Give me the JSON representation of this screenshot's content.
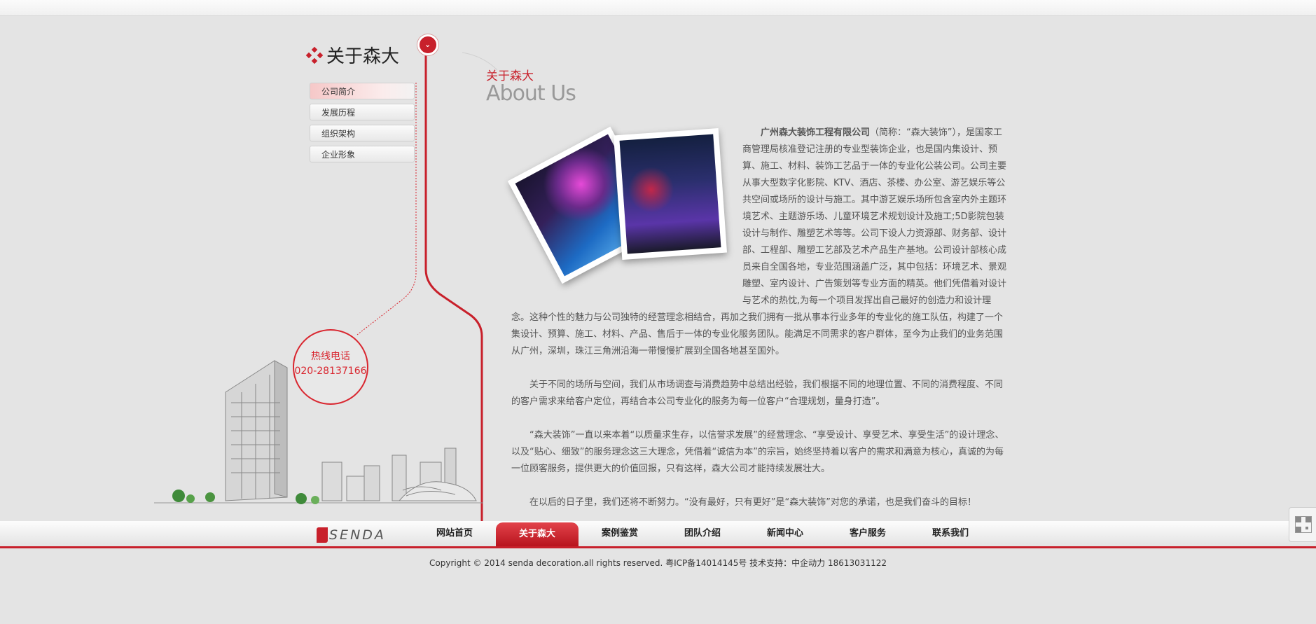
{
  "sidebar": {
    "title": "关于森大",
    "items": [
      {
        "label": "公司简介",
        "active": true
      },
      {
        "label": "发展历程",
        "active": false
      },
      {
        "label": "组织架构",
        "active": false
      },
      {
        "label": "企业形象",
        "active": false
      }
    ],
    "toggle_icon": "chevron-down-icon",
    "hotline": {
      "label": "热线电话",
      "number": "020-28137166"
    }
  },
  "main": {
    "title_cn": "关于森大",
    "title_en": "About Us",
    "intro_company": "广州森大装饰工程有限公司",
    "intro_text": "（简称：“森大装饰”），是国家工商管理局核准登记注册的专业型装饰企业，也是国内集设计、预算、施工、材料、装饰工艺品于一体的专业化公装公司。公司主要从事大型数字化影院、KTV、酒店、茶楼、办公室、游艺娱乐等公共空间或场所的设计与施工。其中游艺娱乐场所包含室内外主题环境艺术、主题游乐场、儿童环境艺术规划设计及施工;5D影院包装设计与制作、雕塑艺术等等。公司下设人力资源部、财务部、设计部、工程部、雕塑工艺部及艺术产品生产基地。公司设计部核心成员来自全国各地，专业范围涵盖广泛，其中包括：环境艺术、景观雕塑、室内设计、广告策划等专业方面的精英。他们凭借着对设计与艺术的热忱,为每一个项目发挥出自己最好的创造力和设计理",
    "para1_tail": "念。这种个性的魅力与公司独特的经营理念相结合，再加之我们拥有一批从事本行业多年的专业化的施工队伍，构建了一个集设计、预算、施工、材料、产品、售后于一体的专业化服务团队。能满足不同需求的客户群体，至今为止我们的业务范围从广州，深圳，珠江三角洲沿海一带慢慢扩展到全国各地甚至国外。",
    "para2": "关于不同的场所与空间，我们从市场调查与消费趋势中总结出经验，我们根据不同的地理位置、不同的消费程度、不同的客户需求来给客户定位，再结合本公司专业化的服务为每一位客户“合理规划，量身打造”。",
    "para3": "“森大装饰”一直以来本着“以质量求生存，以信誉求发展”的经营理念、“享受设计、享受艺术、享受生活”的设计理念、以及“贴心、细致”的服务理念这三大理念，凭借着“诚信为本”的宗旨，始终坚持着以客户的需求和满意为核心，真诚的为每一位顾客服务，提供更大的价值回报，只有这样，森大公司才能持续发展壮大。",
    "para4": "在以后的日子里，我们还将不断努力。“没有最好，只有更好”是“森大装饰”对您的承诺，也是我们奋斗的目标！"
  },
  "footer": {
    "logo_text": "SENDA",
    "nav": [
      {
        "label": "网站首页",
        "active": false
      },
      {
        "label": "关于森大",
        "active": true
      },
      {
        "label": "案例鉴赏",
        "active": false
      },
      {
        "label": "团队介绍",
        "active": false
      },
      {
        "label": "新闻中心",
        "active": false
      },
      {
        "label": "客户服务",
        "active": false
      },
      {
        "label": "联系我们",
        "active": false
      }
    ],
    "copyright": "Copyright © 2014 senda decoration.all rights reserved.  粤ICP备14014145号  技术支持：中企动力 18613031122",
    "qr_icon": "qr-code-icon"
  },
  "colors": {
    "accent": "#c8202b",
    "background": "#e4e4e4"
  }
}
